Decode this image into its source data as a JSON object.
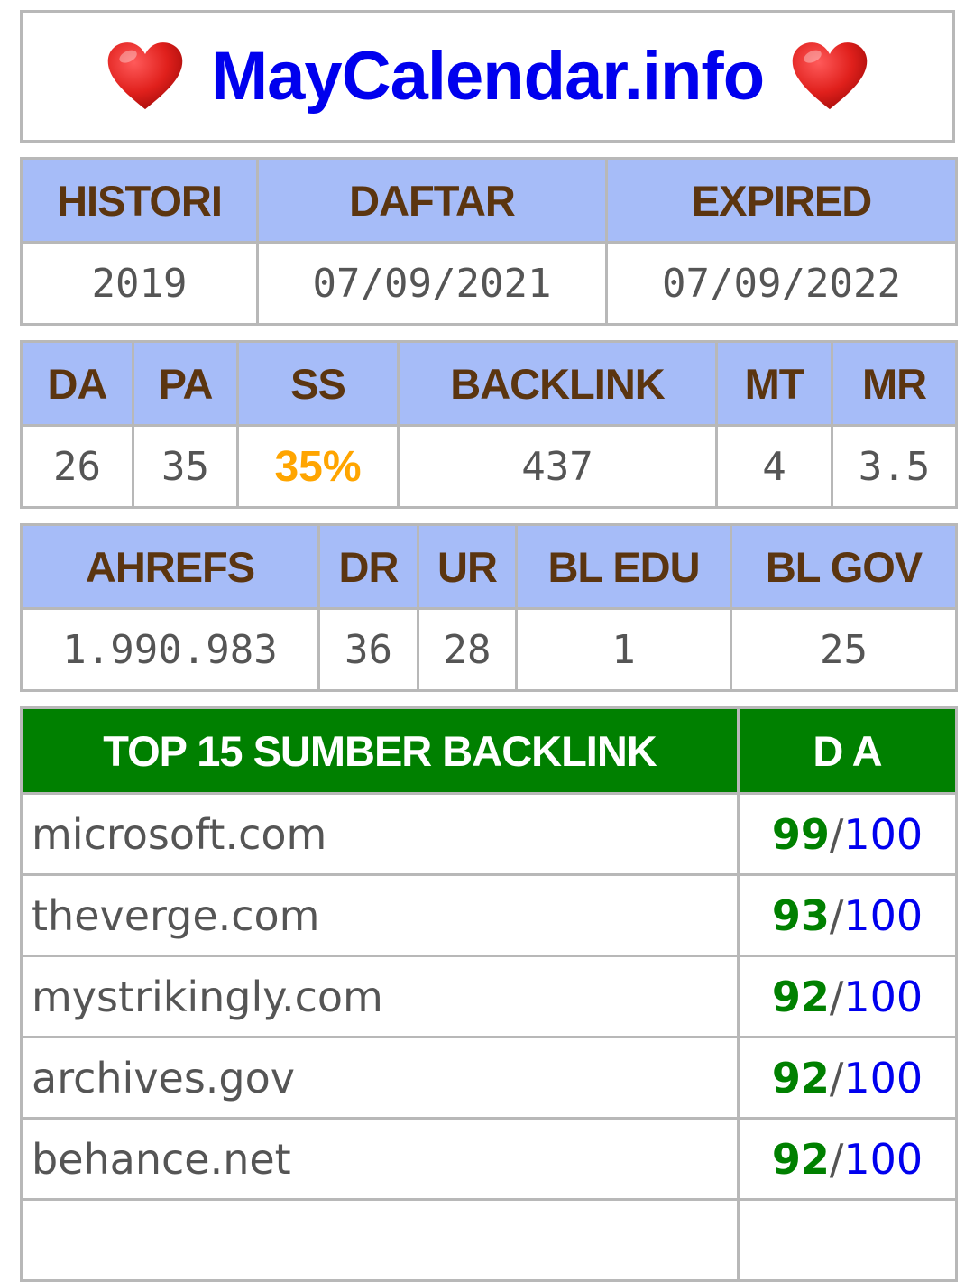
{
  "header": {
    "title": "MayCalendar.info",
    "icon": "red-heart"
  },
  "domain_info": {
    "headers": [
      "HISTORI",
      "DAFTAR",
      "EXPIRED"
    ],
    "values": [
      "2019",
      "07/09/2021",
      "07/09/2022"
    ]
  },
  "moz": {
    "headers": [
      "DA",
      "PA",
      "SS",
      "BACKLINK",
      "MT",
      "MR"
    ],
    "values": [
      "26",
      "35",
      "35%",
      "437",
      "4",
      "3.5"
    ]
  },
  "ahrefs": {
    "headers": [
      "AHREFS",
      "DR",
      "UR",
      "BL EDU",
      "BL GOV"
    ],
    "values": [
      "1.990.983",
      "36",
      "28",
      "1",
      "25"
    ]
  },
  "backlinks": {
    "header_source": "TOP 15 SUMBER BACKLINK",
    "header_da": "D A",
    "max": "100",
    "rows": [
      {
        "domain": "microsoft.com",
        "da": "99"
      },
      {
        "domain": "theverge.com",
        "da": "93"
      },
      {
        "domain": "mystrikingly.com",
        "da": "92"
      },
      {
        "domain": "archives.gov",
        "da": "92"
      },
      {
        "domain": "behance.net",
        "da": "92"
      }
    ]
  },
  "colors": {
    "title": "#0000ee",
    "header_bg": "#a6bcf8",
    "header_text": "#5b3510",
    "ss_value": "#ffa500",
    "backlink_header_bg": "#008000",
    "da_score": "#008000",
    "da_max": "#0000ee"
  }
}
